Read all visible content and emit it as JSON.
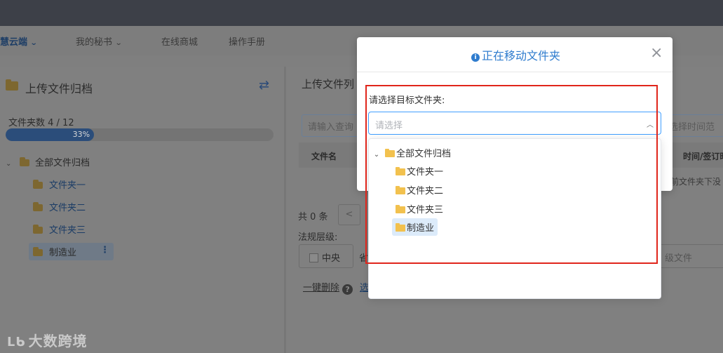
{
  "nav": {
    "brand": "慧云端",
    "items": [
      "我的秘书",
      "在线商城",
      "操作手册"
    ]
  },
  "left_panel": {
    "title": "上传文件归档",
    "folder_count_label": "文件夹数 4 / 12",
    "progress": {
      "percent": 33,
      "label": "33%"
    },
    "tree": {
      "root": "全部文件归档",
      "children": [
        "文件夹一",
        "文件夹二",
        "文件夹三",
        "制造业"
      ],
      "active": "制造业"
    }
  },
  "right_panel": {
    "title": "上传文件列",
    "search_placeholder": "请输入查询",
    "date_placeholder": "选择时间范",
    "col_filename": "文件名",
    "col_time": "时间/签订时间",
    "empty_text": "前文件夹下没",
    "pager_total": "共 0 条",
    "prev_glyph": "<",
    "level_label": "法规层级:",
    "level_option": "中央",
    "level_option2": "省",
    "filetype_placeholder": "级文件",
    "onekey_delete": "一键删除",
    "select_link": "选"
  },
  "modal": {
    "title": "正在移动文件夹",
    "label": "请选择目标文件夹:",
    "select_placeholder": "请选择",
    "dropdown": {
      "root": "全部文件归档",
      "children": [
        "文件夹一",
        "文件夹二",
        "文件夹三",
        "制造业"
      ],
      "selected": "制造业"
    }
  },
  "watermark": "大数跨境",
  "colors": {
    "accent": "#2f7cce",
    "highlight_border": "#e0251b",
    "folder_yellow": "#f2c14e",
    "selected_bg": "#dcebfa"
  },
  "icons": {
    "swap": "swap-arrows-icon",
    "close": "close-icon",
    "info": "info-icon",
    "help": "help-icon"
  }
}
